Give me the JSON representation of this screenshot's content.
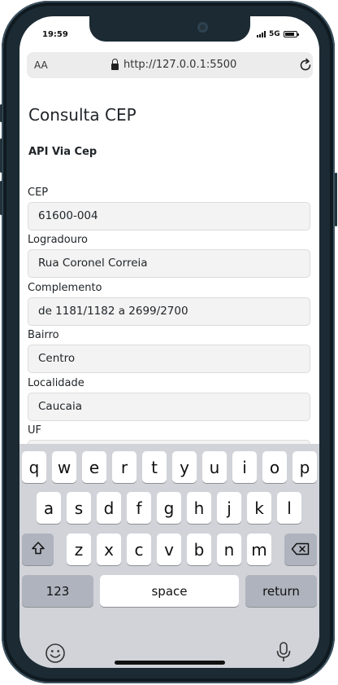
{
  "status_bar": {
    "time": "19:59",
    "network": "5G"
  },
  "browser": {
    "aa_label": "AA",
    "url": "http://127.0.0.1:5500"
  },
  "page": {
    "title": "Consulta CEP",
    "subtitle": "API Via Cep",
    "fields": [
      {
        "label": "CEP",
        "value": "61600-004"
      },
      {
        "label": "Logradouro",
        "value": "Rua Coronel Correia"
      },
      {
        "label": "Complemento",
        "value": "de 1181/1182 a 2699/2700"
      },
      {
        "label": "Bairro",
        "value": "Centro"
      },
      {
        "label": "Localidade",
        "value": "Caucaia"
      },
      {
        "label": "UF",
        "value": ""
      }
    ]
  },
  "keyboard": {
    "row1": [
      "q",
      "w",
      "e",
      "r",
      "t",
      "y",
      "u",
      "i",
      "o",
      "p"
    ],
    "row2": [
      "a",
      "s",
      "d",
      "f",
      "g",
      "h",
      "j",
      "k",
      "l"
    ],
    "row3": [
      "z",
      "x",
      "c",
      "v",
      "b",
      "n",
      "m"
    ],
    "shift_icon": "shift-arrow-icon",
    "backspace_icon": "backspace-icon",
    "numbers_label": "123",
    "space_label": "space",
    "return_label": "return",
    "emoji_icon": "emoji-icon",
    "mic_icon": "microphone-icon"
  }
}
